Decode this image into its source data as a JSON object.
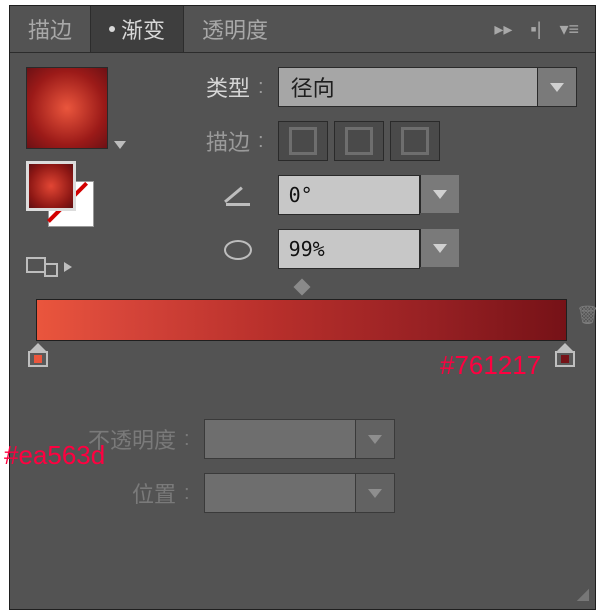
{
  "tabs": {
    "stroke_tab": "描边",
    "gradient_tab": "渐变",
    "transparency_tab": "透明度"
  },
  "fields": {
    "type_label": "类型",
    "type_value": "径向",
    "stroke_label": "描边",
    "angle_value": "0°",
    "ratio_value": "99%",
    "opacity_label": "不透明度",
    "position_label": "位置",
    "colon": ":"
  },
  "gradient": {
    "start_hex": "#ea563d",
    "end_hex": "#761217"
  }
}
